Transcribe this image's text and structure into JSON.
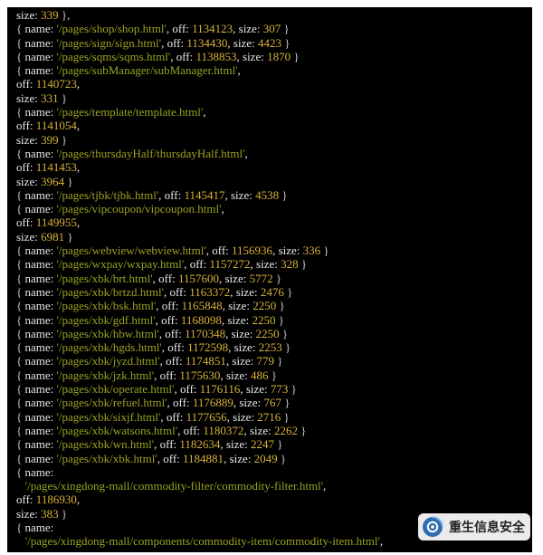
{
  "colors": {
    "background": "#000000",
    "key_text": "#e8e8e8",
    "string_value": "#9aa321",
    "number_value": "#d8b23a",
    "punctuation": "#c8c8c8"
  },
  "terminal": {
    "lines": [
      [
        [
          "w",
          "size: "
        ],
        [
          "y",
          "339"
        ],
        [
          "p",
          " },"
        ]
      ],
      [
        [
          "p",
          "{ "
        ],
        [
          "w",
          "name: "
        ],
        [
          "g",
          "'/pages/shop/shop.html'"
        ],
        [
          "w",
          ", off: "
        ],
        [
          "y",
          "1134123"
        ],
        [
          "w",
          ", size: "
        ],
        [
          "y",
          "307"
        ],
        [
          "p",
          " }"
        ]
      ],
      [
        [
          "p",
          "{ "
        ],
        [
          "w",
          "name: "
        ],
        [
          "g",
          "'/pages/sign/sign.html'"
        ],
        [
          "w",
          ", off: "
        ],
        [
          "y",
          "1134430"
        ],
        [
          "w",
          ", size: "
        ],
        [
          "y",
          "4423"
        ],
        [
          "p",
          " }"
        ]
      ],
      [
        [
          "p",
          "{ "
        ],
        [
          "w",
          "name: "
        ],
        [
          "g",
          "'/pages/sqms/sqms.html'"
        ],
        [
          "w",
          ", off: "
        ],
        [
          "y",
          "1138853"
        ],
        [
          "w",
          ", size: "
        ],
        [
          "y",
          "1870"
        ],
        [
          "p",
          " }"
        ]
      ],
      [
        [
          "p",
          "{ "
        ],
        [
          "w",
          "name: "
        ],
        [
          "g",
          "'/pages/subManager/subManager.html'"
        ],
        [
          "w",
          ","
        ]
      ],
      [
        [
          "w",
          "off: "
        ],
        [
          "y",
          "1140723"
        ],
        [
          "w",
          ","
        ]
      ],
      [
        [
          "w",
          "size: "
        ],
        [
          "y",
          "331"
        ],
        [
          "p",
          " }"
        ]
      ],
      [
        [
          "p",
          "{ "
        ],
        [
          "w",
          "name: "
        ],
        [
          "g",
          "'/pages/template/template.html'"
        ],
        [
          "w",
          ","
        ]
      ],
      [
        [
          "w",
          "off: "
        ],
        [
          "y",
          "1141054"
        ],
        [
          "w",
          ","
        ]
      ],
      [
        [
          "w",
          "size: "
        ],
        [
          "y",
          "399"
        ],
        [
          "p",
          " }"
        ]
      ],
      [
        [
          "p",
          "{ "
        ],
        [
          "w",
          "name: "
        ],
        [
          "g",
          "'/pages/thursdayHalf/thursdayHalf.html'"
        ],
        [
          "w",
          ","
        ]
      ],
      [
        [
          "w",
          "off: "
        ],
        [
          "y",
          "1141453"
        ],
        [
          "w",
          ","
        ]
      ],
      [
        [
          "w",
          "size: "
        ],
        [
          "y",
          "3964"
        ],
        [
          "p",
          " }"
        ]
      ],
      [
        [
          "p",
          "{ "
        ],
        [
          "w",
          "name: "
        ],
        [
          "g",
          "'/pages/tjbk/tjbk.html'"
        ],
        [
          "w",
          ", off: "
        ],
        [
          "y",
          "1145417"
        ],
        [
          "w",
          ", size: "
        ],
        [
          "y",
          "4538"
        ],
        [
          "p",
          " }"
        ]
      ],
      [
        [
          "p",
          "{ "
        ],
        [
          "w",
          "name: "
        ],
        [
          "g",
          "'/pages/vipcoupon/vipcoupon.html'"
        ],
        [
          "w",
          ","
        ]
      ],
      [
        [
          "w",
          "off: "
        ],
        [
          "y",
          "1149955"
        ],
        [
          "w",
          ","
        ]
      ],
      [
        [
          "w",
          "size: "
        ],
        [
          "y",
          "6981"
        ],
        [
          "p",
          " }"
        ]
      ],
      [
        [
          "p",
          "{ "
        ],
        [
          "w",
          "name: "
        ],
        [
          "g",
          "'/pages/webview/webview.html'"
        ],
        [
          "w",
          ", off: "
        ],
        [
          "y",
          "1156936"
        ],
        [
          "w",
          ", size: "
        ],
        [
          "y",
          "336"
        ],
        [
          "p",
          " }"
        ]
      ],
      [
        [
          "p",
          "{ "
        ],
        [
          "w",
          "name: "
        ],
        [
          "g",
          "'/pages/wxpay/wxpay.html'"
        ],
        [
          "w",
          ", off: "
        ],
        [
          "y",
          "1157272"
        ],
        [
          "w",
          ", size: "
        ],
        [
          "y",
          "328"
        ],
        [
          "p",
          " }"
        ]
      ],
      [
        [
          "p",
          "{ "
        ],
        [
          "w",
          "name: "
        ],
        [
          "g",
          "'/pages/xbk/brt.html'"
        ],
        [
          "w",
          ", off: "
        ],
        [
          "y",
          "1157600"
        ],
        [
          "w",
          ", size: "
        ],
        [
          "y",
          "5772"
        ],
        [
          "p",
          " }"
        ]
      ],
      [
        [
          "p",
          "{ "
        ],
        [
          "w",
          "name: "
        ],
        [
          "g",
          "'/pages/xbk/brtzd.html'"
        ],
        [
          "w",
          ", off: "
        ],
        [
          "y",
          "1163372"
        ],
        [
          "w",
          ", size: "
        ],
        [
          "y",
          "2476"
        ],
        [
          "p",
          " }"
        ]
      ],
      [
        [
          "p",
          "{ "
        ],
        [
          "w",
          "name: "
        ],
        [
          "g",
          "'/pages/xbk/bsk.html'"
        ],
        [
          "w",
          ", off: "
        ],
        [
          "y",
          "1165848"
        ],
        [
          "w",
          ", size: "
        ],
        [
          "y",
          "2250"
        ],
        [
          "p",
          " }"
        ]
      ],
      [
        [
          "p",
          "{ "
        ],
        [
          "w",
          "name: "
        ],
        [
          "g",
          "'/pages/xbk/gdf.html'"
        ],
        [
          "w",
          ", off: "
        ],
        [
          "y",
          "1168098"
        ],
        [
          "w",
          ", size: "
        ],
        [
          "y",
          "2250"
        ],
        [
          "p",
          " }"
        ]
      ],
      [
        [
          "p",
          "{ "
        ],
        [
          "w",
          "name: "
        ],
        [
          "g",
          "'/pages/xbk/hbw.html'"
        ],
        [
          "w",
          ", off: "
        ],
        [
          "y",
          "1170348"
        ],
        [
          "w",
          ", size: "
        ],
        [
          "y",
          "2250"
        ],
        [
          "p",
          " }"
        ]
      ],
      [
        [
          "p",
          "{ "
        ],
        [
          "w",
          "name: "
        ],
        [
          "g",
          "'/pages/xbk/hgds.html'"
        ],
        [
          "w",
          ", off: "
        ],
        [
          "y",
          "1172598"
        ],
        [
          "w",
          ", size: "
        ],
        [
          "y",
          "2253"
        ],
        [
          "p",
          " }"
        ]
      ],
      [
        [
          "p",
          "{ "
        ],
        [
          "w",
          "name: "
        ],
        [
          "g",
          "'/pages/xbk/jyzd.html'"
        ],
        [
          "w",
          ", off: "
        ],
        [
          "y",
          "1174851"
        ],
        [
          "w",
          ", size: "
        ],
        [
          "y",
          "779"
        ],
        [
          "p",
          " }"
        ]
      ],
      [
        [
          "p",
          "{ "
        ],
        [
          "w",
          "name: "
        ],
        [
          "g",
          "'/pages/xbk/jzk.html'"
        ],
        [
          "w",
          ", off: "
        ],
        [
          "y",
          "1175630"
        ],
        [
          "w",
          ", size: "
        ],
        [
          "y",
          "486"
        ],
        [
          "p",
          " }"
        ]
      ],
      [
        [
          "p",
          "{ "
        ],
        [
          "w",
          "name: "
        ],
        [
          "g",
          "'/pages/xbk/operate.html'"
        ],
        [
          "w",
          ", off: "
        ],
        [
          "y",
          "1176116"
        ],
        [
          "w",
          ", size: "
        ],
        [
          "y",
          "773"
        ],
        [
          "p",
          " }"
        ]
      ],
      [
        [
          "p",
          "{ "
        ],
        [
          "w",
          "name: "
        ],
        [
          "g",
          "'/pages/xbk/refuel.html'"
        ],
        [
          "w",
          ", off: "
        ],
        [
          "y",
          "1176889"
        ],
        [
          "w",
          ", size: "
        ],
        [
          "y",
          "767"
        ],
        [
          "p",
          " }"
        ]
      ],
      [
        [
          "p",
          "{ "
        ],
        [
          "w",
          "name: "
        ],
        [
          "g",
          "'/pages/xbk/sixjf.html'"
        ],
        [
          "w",
          ", off: "
        ],
        [
          "y",
          "1177656"
        ],
        [
          "w",
          ", size: "
        ],
        [
          "y",
          "2716"
        ],
        [
          "p",
          " }"
        ]
      ],
      [
        [
          "p",
          "{ "
        ],
        [
          "w",
          "name: "
        ],
        [
          "g",
          "'/pages/xbk/watsons.html'"
        ],
        [
          "w",
          ", off: "
        ],
        [
          "y",
          "1180372"
        ],
        [
          "w",
          ", size: "
        ],
        [
          "y",
          "2262"
        ],
        [
          "p",
          " }"
        ]
      ],
      [
        [
          "p",
          "{ "
        ],
        [
          "w",
          "name: "
        ],
        [
          "g",
          "'/pages/xbk/wn.html'"
        ],
        [
          "w",
          ", off: "
        ],
        [
          "y",
          "1182634"
        ],
        [
          "w",
          ", size: "
        ],
        [
          "y",
          "2247"
        ],
        [
          "p",
          " }"
        ]
      ],
      [
        [
          "p",
          "{ "
        ],
        [
          "w",
          "name: "
        ],
        [
          "g",
          "'/pages/xbk/xbk.html'"
        ],
        [
          "w",
          ", off: "
        ],
        [
          "y",
          "1184881"
        ],
        [
          "w",
          ", size: "
        ],
        [
          "y",
          "2049"
        ],
        [
          "p",
          " }"
        ]
      ],
      [
        [
          "p",
          "{ "
        ],
        [
          "w",
          "name:"
        ]
      ],
      [
        [
          "g",
          "   '/pages/xingdong-mall/commodity-filter/commodity-filter.html'"
        ],
        [
          "w",
          ","
        ]
      ],
      [
        [
          "w",
          "off: "
        ],
        [
          "y",
          "1186930"
        ],
        [
          "w",
          ","
        ]
      ],
      [
        [
          "w",
          "size: "
        ],
        [
          "y",
          "383"
        ],
        [
          "p",
          " }"
        ]
      ],
      [
        [
          "p",
          "{ "
        ],
        [
          "w",
          "name:"
        ]
      ],
      [
        [
          "g",
          "   '/pages/xingdong-mall/components/commodity-item/commodity-item.html'"
        ],
        [
          "w",
          ","
        ]
      ]
    ]
  },
  "watermark": {
    "icon": "wechat-official-account-icon",
    "text": "重生信息安全"
  }
}
